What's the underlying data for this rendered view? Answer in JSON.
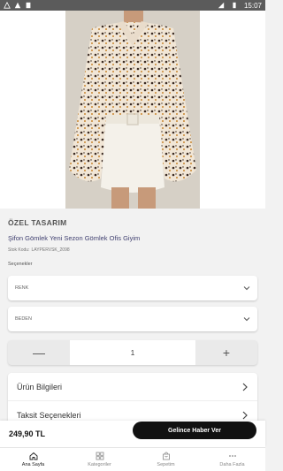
{
  "status_bar": {
    "time": "15:07"
  },
  "product": {
    "brand": "ÖZEL TASARIM",
    "title": "Şifon Gömlek Yeni Sezon Gömlek Ofis Giyim",
    "sku_label": "Stok Kodu:",
    "sku_value": "LAYPERVSK_2098",
    "options_label": "Seçenekler",
    "selects": [
      {
        "label": "RENK",
        "value": ""
      },
      {
        "label": "BEDEN",
        "value": ""
      }
    ],
    "quantity": "1",
    "minus_symbol": "—",
    "plus_symbol": "+"
  },
  "accordion": [
    {
      "label": "Ürün Bilgileri"
    },
    {
      "label": "Taksit Seçenekleri"
    }
  ],
  "buy_bar": {
    "price": "249,90 TL",
    "notify_label": "Gelince Haber Ver"
  },
  "tabbar": {
    "items": [
      {
        "label": "Ana Sayfa",
        "icon": "home-icon",
        "active": true
      },
      {
        "label": "Kategoriler",
        "icon": "grid-icon",
        "active": false
      },
      {
        "label": "Sepetim",
        "icon": "cart-icon",
        "active": false
      },
      {
        "label": "Daha Fazla",
        "icon": "more-icon",
        "active": false
      }
    ]
  },
  "colors": {
    "accent": "#111111",
    "title_text": "#3f3f6f"
  }
}
